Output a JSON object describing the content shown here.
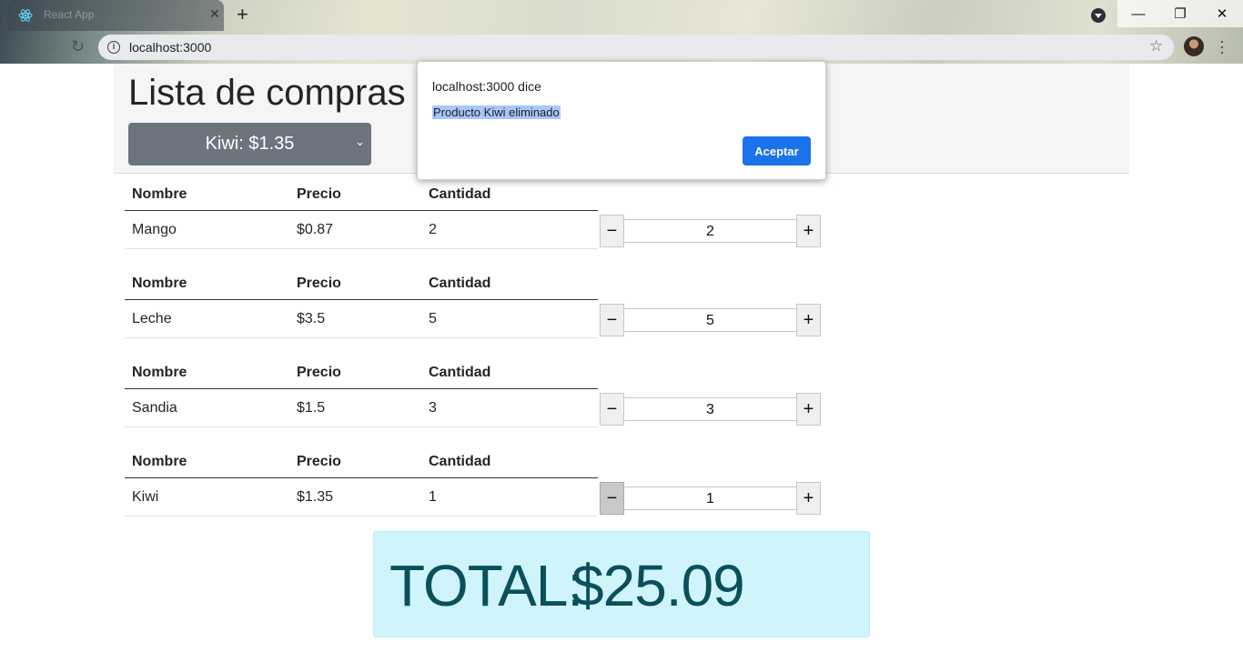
{
  "browser": {
    "tab_title": "React App",
    "url": "localhost:3000"
  },
  "app": {
    "title": "Lista de compras",
    "selected_product": "Kiwi: $1.35"
  },
  "table": {
    "headers": [
      "Nombre",
      "Precio",
      "Cantidad"
    ],
    "items": [
      {
        "name": "Mango",
        "price": "$0.87",
        "qty": "2"
      },
      {
        "name": "Leche",
        "price": "$3.5",
        "qty": "5"
      },
      {
        "name": "Sandia",
        "price": "$1.5",
        "qty": "3"
      },
      {
        "name": "Kiwi",
        "price": "$1.35",
        "qty": "1"
      }
    ],
    "minus_symbol": "−",
    "plus_symbol": "+"
  },
  "total": {
    "label": "TOTAL:",
    "value": "$25.09"
  },
  "dialog": {
    "title": "localhost:3000 dice",
    "message": "Producto Kiwi eliminado",
    "accept_label": "Aceptar"
  },
  "colors": {
    "select_bg": "#6c757d",
    "total_bg": "#cff4fb",
    "dialog_button": "#1a73e8"
  }
}
